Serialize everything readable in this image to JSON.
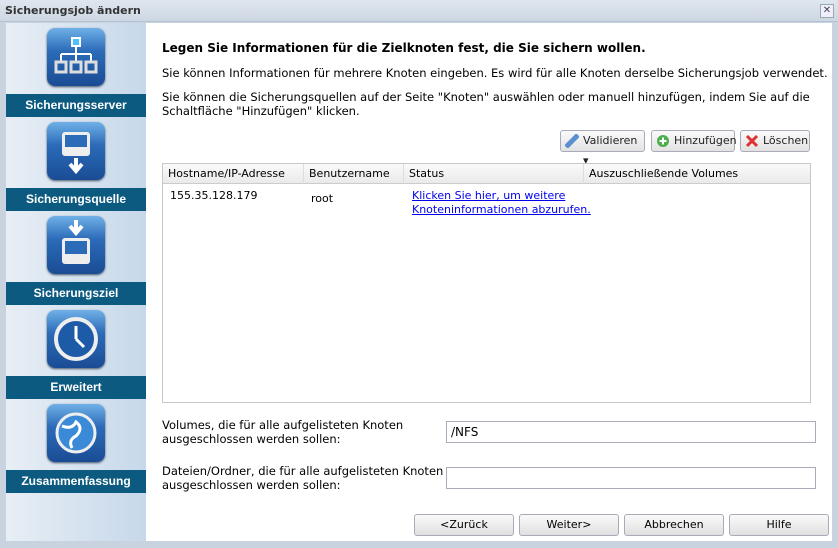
{
  "window": {
    "title": "Sicherungsjob ändern",
    "close": "✕"
  },
  "steps": [
    {
      "label": "Sicherungsserver",
      "icon": "network-server-icon"
    },
    {
      "label": "Sicherungsquelle",
      "icon": "disk-download-icon"
    },
    {
      "label": "Sicherungsziel",
      "icon": "disk-target-icon"
    },
    {
      "label": "Erweitert",
      "icon": "clock-icon"
    },
    {
      "label": "Zusammenfassung",
      "icon": "globe-icon"
    }
  ],
  "main": {
    "heading": "Legen Sie Informationen für die Zielknoten fest, die Sie sichern wollen.",
    "para1": "Sie können Informationen für mehrere Knoten eingeben. Es wird für alle Knoten derselbe Sicherungsjob verwendet.",
    "para2a": "Sie können die Sicherungsquellen auf der Seite \"Knoten\" auswählen oder manuell hinzufügen, indem Sie auf die",
    "para2b": "Schaltfläche \"Hinzufügen\" klicken.",
    "toolbar": {
      "validate": "Validieren",
      "add": "Hinzufügen",
      "delete": "Löschen"
    },
    "table": {
      "headers": [
        "Hostname/IP-Adresse",
        "Benutzername",
        "Status",
        "Auszuschließende Volumes"
      ],
      "rows": [
        {
          "host": "155.35.128.179",
          "user": "root",
          "status1": "Klicken Sie hier, um weitere ",
          "status2": "Knoteninformationen abzurufen.",
          "volumes": ""
        }
      ]
    },
    "volumes_label1": "Volumes, die für alle aufgelisteten Knoten",
    "volumes_label2": "ausgeschlossen werden sollen:",
    "volumes_value": "/NFS",
    "files_label1": "Dateien/Ordner, die für alle aufgelisteten Knoten",
    "files_label2": "ausgeschlossen werden sollen:",
    "files_value": ""
  },
  "footer": {
    "back": "<Zurück",
    "next": "Weiter>",
    "cancel": "Abbrechen",
    "help": "Hilfe"
  }
}
